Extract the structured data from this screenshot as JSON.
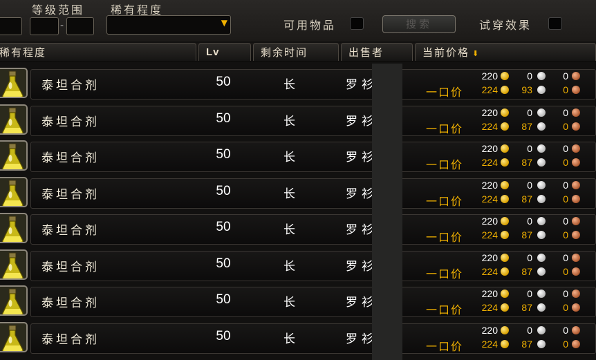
{
  "filters": {
    "level_range_label": "等级范围",
    "level_dash": "-",
    "rarity_label": "稀有程度",
    "usable_label": "可用物品",
    "search_button": "搜索",
    "preview_label": "试穿效果"
  },
  "columns": {
    "rarity": "稀有程度",
    "lv": "Lv",
    "time_left": "剩余时间",
    "seller": "出售者",
    "current_price": "当前价格"
  },
  "rows": [
    {
      "name": "泰坦合剂",
      "lv": "50",
      "time": "长",
      "seller": "罗衫",
      "bid_gold": "220",
      "bid_silver": "0",
      "bid_copper": "0",
      "buyout_label": "一口价",
      "bo_gold": "224",
      "bo_silver": "93",
      "bo_copper": "0"
    },
    {
      "name": "泰坦合剂",
      "lv": "50",
      "time": "长",
      "seller": "罗衫",
      "bid_gold": "220",
      "bid_silver": "0",
      "bid_copper": "0",
      "buyout_label": "一口价",
      "bo_gold": "224",
      "bo_silver": "87",
      "bo_copper": "0"
    },
    {
      "name": "泰坦合剂",
      "lv": "50",
      "time": "长",
      "seller": "罗衫",
      "bid_gold": "220",
      "bid_silver": "0",
      "bid_copper": "0",
      "buyout_label": "一口价",
      "bo_gold": "224",
      "bo_silver": "87",
      "bo_copper": "0"
    },
    {
      "name": "泰坦合剂",
      "lv": "50",
      "time": "长",
      "seller": "罗衫",
      "bid_gold": "220",
      "bid_silver": "0",
      "bid_copper": "0",
      "buyout_label": "一口价",
      "bo_gold": "224",
      "bo_silver": "87",
      "bo_copper": "0"
    },
    {
      "name": "泰坦合剂",
      "lv": "50",
      "time": "长",
      "seller": "罗衫",
      "bid_gold": "220",
      "bid_silver": "0",
      "bid_copper": "0",
      "buyout_label": "一口价",
      "bo_gold": "224",
      "bo_silver": "87",
      "bo_copper": "0"
    },
    {
      "name": "泰坦合剂",
      "lv": "50",
      "time": "长",
      "seller": "罗衫",
      "bid_gold": "220",
      "bid_silver": "0",
      "bid_copper": "0",
      "buyout_label": "一口价",
      "bo_gold": "224",
      "bo_silver": "87",
      "bo_copper": "0"
    },
    {
      "name": "泰坦合剂",
      "lv": "50",
      "time": "长",
      "seller": "罗衫",
      "bid_gold": "220",
      "bid_silver": "0",
      "bid_copper": "0",
      "buyout_label": "一口价",
      "bo_gold": "224",
      "bo_silver": "87",
      "bo_copper": "0"
    },
    {
      "name": "泰坦合剂",
      "lv": "50",
      "time": "长",
      "seller": "罗衫",
      "bid_gold": "220",
      "bid_silver": "0",
      "bid_copper": "0",
      "buyout_label": "一口价",
      "bo_gold": "224",
      "bo_silver": "87",
      "bo_copper": "0"
    }
  ],
  "icons": {
    "item": "flask-icon",
    "gold": "gold-coin-icon",
    "silver": "silver-coin-icon",
    "copper": "copper-coin-icon",
    "sort": "sort-down-arrow-icon"
  },
  "colors": {
    "gold_text": "#f0b000",
    "white_text": "#ffffff"
  }
}
